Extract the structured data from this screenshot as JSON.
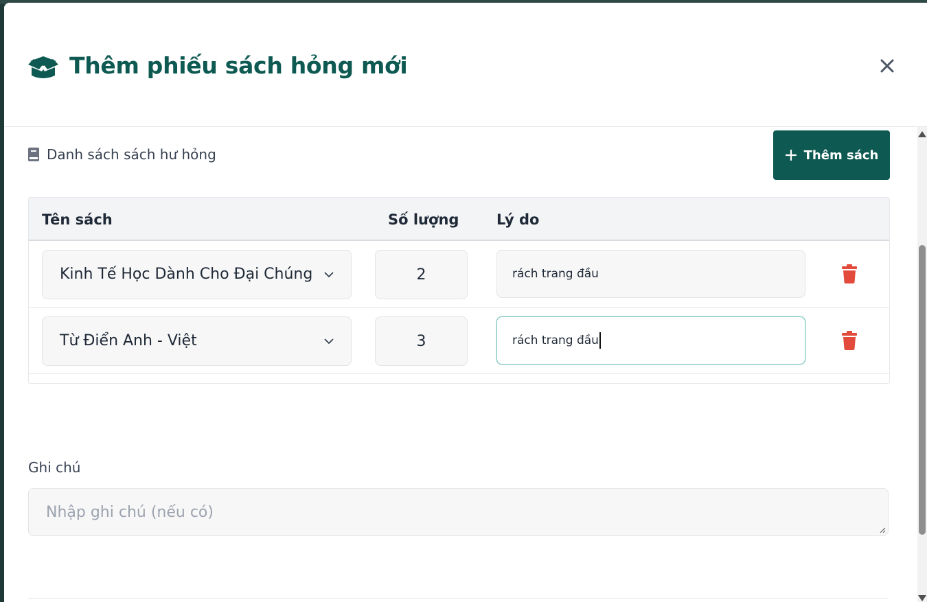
{
  "modal": {
    "title": "Thêm phiếu sách hỏng mới",
    "header_icon": "box-open-icon",
    "close_icon": "close-icon",
    "accent_color": "#0e5a52"
  },
  "section": {
    "icon": "book-icon",
    "title": "Danh sách sách hư hỏng",
    "add_button_label": "Thêm sách"
  },
  "table": {
    "headers": {
      "book": "Tên sách",
      "quantity": "Số lượng",
      "reason": "Lý do"
    },
    "rows": [
      {
        "book": "Kinh Tế Học Dành Cho Đại Chúng",
        "quantity": "2",
        "reason": "rách trang đầu",
        "delete_icon": "trash-icon"
      },
      {
        "book": "Từ Điển Anh - Việt",
        "quantity": "3",
        "reason": "rách trang đầu",
        "delete_icon": "trash-icon",
        "focused": true
      }
    ]
  },
  "note": {
    "label": "Ghi chú",
    "placeholder": "Nhập ghi chú (nếu có)",
    "value": ""
  },
  "colors": {
    "delete": "#e24b3b",
    "focus_border": "#7fc4bd"
  }
}
